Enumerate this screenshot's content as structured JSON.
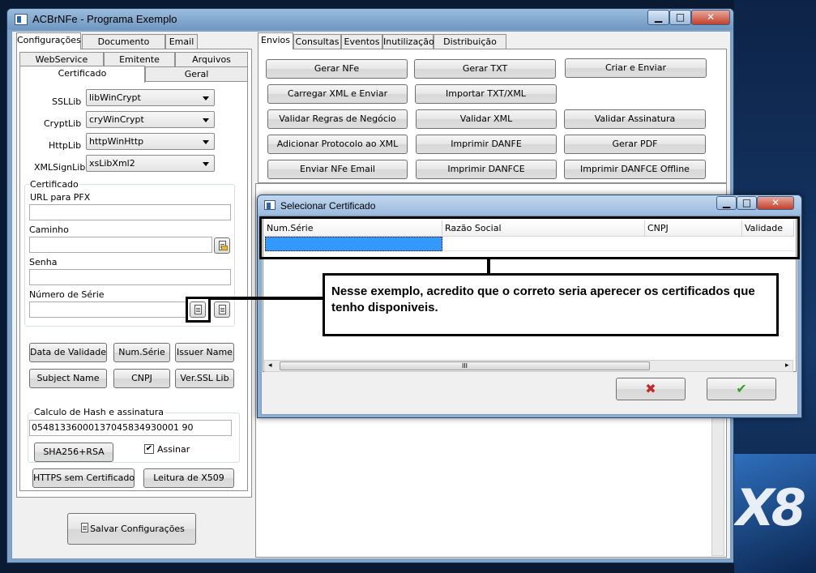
{
  "window": {
    "title": "ACBrNFe - Programa Exemplo"
  },
  "left_tabs": [
    "Configurações",
    "Documento Auxiliar",
    "Email"
  ],
  "config_subtabs_row1": [
    "WebService",
    "Emitente",
    "Arquivos"
  ],
  "config_subtabs_row2": [
    "Certificado",
    "Geral"
  ],
  "cert_libs": [
    {
      "label": "SSLLib",
      "value": "libWinCrypt"
    },
    {
      "label": "CryptLib",
      "value": "cryWinCrypt"
    },
    {
      "label": "HttpLib",
      "value": "httpWinHttp"
    },
    {
      "label": "XMLSignLib",
      "value": "xsLibXml2"
    }
  ],
  "cert_group": {
    "title": "Certificado",
    "url_label": "URL para PFX",
    "caminho_label": "Caminho",
    "senha_label": "Senha",
    "serie_label": "Número de Série"
  },
  "cert_buttons": [
    "Data de Validade",
    "Num.Série",
    "Issuer Name",
    "Subject Name",
    "CNPJ",
    "Ver.SSL Lib"
  ],
  "hash_group": {
    "title": "Calculo de Hash e assinatura",
    "value": "05481336000137045834930001 90",
    "button": "SHA256+RSA",
    "checkbox_label": "Assinar",
    "checked": true
  },
  "bottom_buttons": [
    "HTTPS sem Certificado",
    "Leitura de X509"
  ],
  "save_button": "Salvar Configurações",
  "right_tabs": [
    "Envios",
    "Consultas",
    "Eventos",
    "Inutilização",
    "Distribuição DFe"
  ],
  "action_buttons": [
    [
      "Gerar NFe",
      "Gerar TXT",
      "Criar e Enviar"
    ],
    [
      "Carregar XML e Enviar",
      "Importar TXT/XML",
      ""
    ],
    [
      "Validar Regras de Negócio",
      "Validar XML",
      "Validar Assinatura"
    ],
    [
      "Adicionar Protocolo ao XML",
      "Imprimir DANFE",
      "Gerar PDF"
    ],
    [
      "Enviar NFe Email",
      "Imprimir DANFCE",
      "Imprimir DANFCE Offline"
    ]
  ],
  "dialog": {
    "title": "Selecionar Certificado",
    "columns": [
      "Num.Série",
      "Razão Social",
      "CNPJ",
      "Validade"
    ],
    "scroll_thumb": "III",
    "cancel_icon": "✖",
    "ok_icon": "✔"
  },
  "annotation": "Nesse exemplo, acredito que o correto seria aperecer os certificados que tenho disponiveis.",
  "desktop_logo": "X8",
  "colors": {
    "selection": "#3399ff",
    "cancel": "#c0282a",
    "ok": "#3a9a2a"
  }
}
